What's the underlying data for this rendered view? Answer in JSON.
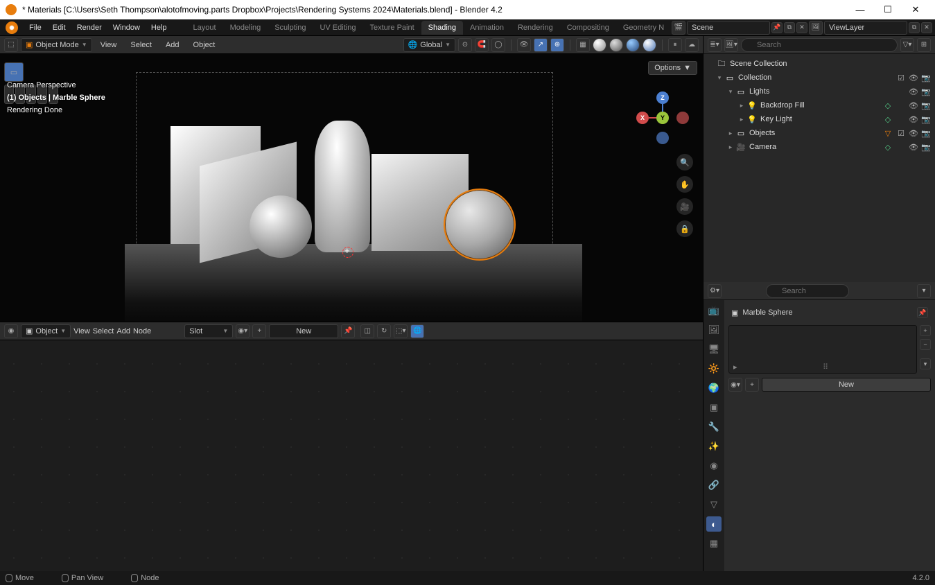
{
  "window": {
    "title": "* Materials [C:\\Users\\Seth Thompson\\alotofmoving.parts Dropbox\\Projects\\Rendering Systems 2024\\Materials.blend] - Blender 4.2"
  },
  "menu": {
    "items": [
      "File",
      "Edit",
      "Render",
      "Window",
      "Help"
    ]
  },
  "workspaces": {
    "items": [
      "Layout",
      "Modeling",
      "Sculpting",
      "UV Editing",
      "Texture Paint",
      "Shading",
      "Animation",
      "Rendering",
      "Compositing",
      "Geometry N"
    ],
    "active": 5
  },
  "header_right": {
    "scene": "Scene",
    "viewlayer": "ViewLayer"
  },
  "viewport_header": {
    "mode": "Object Mode",
    "menus": [
      "View",
      "Select",
      "Add",
      "Object"
    ],
    "orientation": "Global",
    "options": "Options"
  },
  "viewport_overlay": {
    "line1": "Camera Perspective",
    "line2": "(1) Objects | Marble Sphere",
    "line3": "Rendering Done"
  },
  "gizmo": {
    "x": "X",
    "y": "Y",
    "z": "Z"
  },
  "node_header": {
    "type": "Object",
    "menus": [
      "View",
      "Select",
      "Add",
      "Node"
    ],
    "slot": "Slot",
    "new": "New"
  },
  "outliner": {
    "search_placeholder": "Search",
    "root": "Scene Collection",
    "items": [
      {
        "label": "Collection",
        "depth": 1,
        "icon": "coll",
        "expanded": true,
        "check": true,
        "eye": true,
        "cam": true
      },
      {
        "label": "Lights",
        "depth": 2,
        "icon": "coll",
        "expanded": true,
        "check": false,
        "eye": true,
        "cam": true
      },
      {
        "label": "Backdrop Fill",
        "depth": 3,
        "icon": "light",
        "expanded": false,
        "eye": true,
        "cam": true,
        "data": true
      },
      {
        "label": "Key Light",
        "depth": 3,
        "icon": "light",
        "expanded": false,
        "eye": true,
        "cam": true,
        "data": true
      },
      {
        "label": "Objects",
        "depth": 2,
        "icon": "coll",
        "expanded": false,
        "check": true,
        "eye": true,
        "cam": true,
        "obj": true
      },
      {
        "label": "Camera",
        "depth": 2,
        "icon": "cam",
        "expanded": false,
        "eye": true,
        "cam": true,
        "camdata": true
      }
    ]
  },
  "properties": {
    "search_placeholder": "Search",
    "object": "Marble Sphere",
    "new": "New"
  },
  "statusbar": {
    "move": "Move",
    "pan": "Pan View",
    "node": "Node",
    "version": "4.2.0"
  }
}
